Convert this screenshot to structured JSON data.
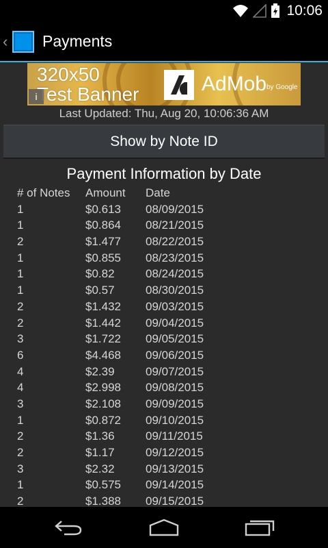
{
  "status_bar": {
    "time": "10:06",
    "icons": [
      "wifi-icon",
      "signal-icon",
      "battery-icon"
    ]
  },
  "action_bar": {
    "title": "Payments",
    "icons": [
      "up-caret-icon",
      "app-icon"
    ]
  },
  "ad_banner": {
    "line1": "320x50",
    "line2": "Test Banner",
    "brand": "AdMob",
    "brand_suffix": "by Google"
  },
  "last_updated": "Last Updated: Thu, Aug 20, 10:06:36 AM",
  "show_by_note_button": "Show by Note ID",
  "section_title": "Payment Information by Date",
  "table": {
    "headers": [
      "# of Notes",
      "Amount",
      "Date"
    ],
    "rows": [
      [
        "1",
        "$0.613",
        "08/09/2015"
      ],
      [
        "1",
        "$0.864",
        "08/21/2015"
      ],
      [
        "2",
        "$1.477",
        "08/22/2015"
      ],
      [
        "1",
        "$0.855",
        "08/23/2015"
      ],
      [
        "1",
        "$0.82",
        "08/24/2015"
      ],
      [
        "1",
        "$0.57",
        "08/30/2015"
      ],
      [
        "2",
        "$1.432",
        "09/03/2015"
      ],
      [
        "2",
        "$1.442",
        "09/04/2015"
      ],
      [
        "3",
        "$1.722",
        "09/05/2015"
      ],
      [
        "6",
        "$4.468",
        "09/06/2015"
      ],
      [
        "4",
        "$2.39",
        "09/07/2015"
      ],
      [
        "4",
        "$2.998",
        "09/08/2015"
      ],
      [
        "3",
        "$2.108",
        "09/09/2015"
      ],
      [
        "1",
        "$0.872",
        "09/10/2015"
      ],
      [
        "2",
        "$1.36",
        "09/11/2015"
      ],
      [
        "2",
        "$1.17",
        "09/12/2015"
      ],
      [
        "3",
        "$2.32",
        "09/13/2015"
      ],
      [
        "1",
        "$0.575",
        "09/14/2015"
      ],
      [
        "2",
        "$1.388",
        "09/15/2015"
      ]
    ]
  },
  "nav_bar": {
    "icons": [
      "back-icon",
      "home-icon",
      "recents-icon"
    ]
  },
  "colors": {
    "accent": "#33b5e5",
    "background": "#2b2b2b",
    "button": "#373a3e"
  }
}
